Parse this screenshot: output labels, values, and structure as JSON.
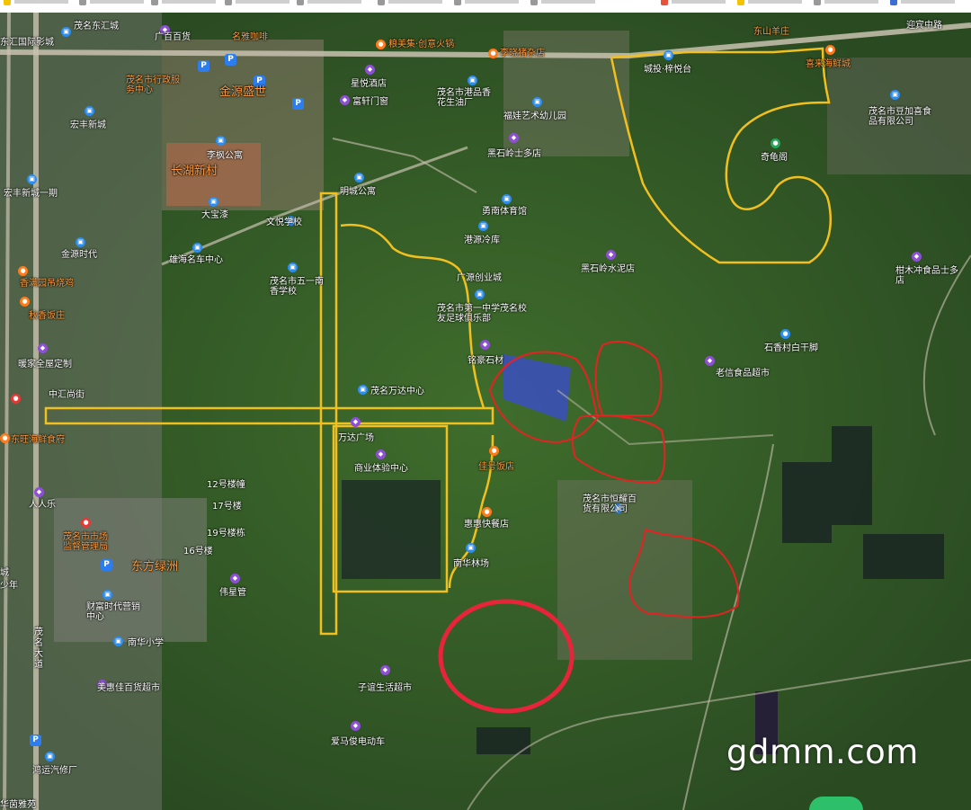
{
  "watermark": "gdmm.com",
  "colors": {
    "yellow_outline": "#f2c01e",
    "red_outline": "#e52222",
    "red_circle": "#e8243a",
    "road": "#c9c2b0"
  },
  "labels": {
    "mz_donghui": "茂名东汇城",
    "guangbai": "广百百货",
    "mingya": "名雅咖啡",
    "dongshan": "东山羊庄",
    "dongjiang": "东汇国际影城",
    "genmeiji": "粮美集·创意火锅",
    "lixiao": "李晓猪杂店",
    "chengtou": "城投·梓悦台",
    "xilai": "喜来海鲜城",
    "admin_center": "茂名市行政服务中心",
    "jinyuan": "金源盛世",
    "xingyue": "星悦酒店",
    "hongfeng": "宏丰新城",
    "fuxuan": "富轩门窗",
    "gangpin": "茂名市港品香花生油厂",
    "fuxin_art": "福娃艺术幼儿园",
    "douliaxi": "茂名市豆加喜食品有限公司",
    "liyu": "李枫公寓",
    "changhu": "长湖新村",
    "heishiling_dorm": "黑石岭士多店",
    "guimian": "奇龟阁",
    "hongfeng_1": "宏丰新城一期",
    "mingcheng": "明城公寓",
    "yongnan": "勇南体育馆",
    "dadao": "大宝漆",
    "wenyue": "文悦学校",
    "jinyuan_time": "金源时代",
    "haihai_car": "雄海名车中心",
    "gangyuan": "港源冷库",
    "heishiling_cement": "黑石岭水泥店",
    "ganmu": "柑木冲食品士多店",
    "xiangman": "香满园吊烧鸡",
    "fifth_school": "茂名市五一南香学校",
    "guangyuan": "广源创业城",
    "qiuyi": "秋香饭庄",
    "first_school": "茂名市第一中学茂名校友足球俱乐部",
    "shixiang": "石香村白干脚",
    "nuanjia": "暖家全屋定制",
    "lingshang": "铭豪石材",
    "laoxin": "老信食品超市",
    "zhonghui": "中汇尚街",
    "wanda_center": "茂名万达中心",
    "dongwang": "东旺海鲜食府",
    "wanda_plaza": "万达广场",
    "biz_center": "商业体验中心",
    "jiahao": "佳号饭店",
    "b12": "12号楼幢",
    "b17": "17号楼",
    "hengzhan": "茂名市恒耀百货有限公司",
    "renrenle": "人人乐",
    "market_admin": "茂名市市场监督管理局",
    "b19": "19号楼栋",
    "b16": "16号楼",
    "huihui": "惠惠快餐店",
    "dongfang": "东方绿洲",
    "nanhua_forest": "南华林场",
    "city_lbl": "城",
    "shaoxian": "少年",
    "caifu": "财富时代营销中心",
    "weixing": "伟星管",
    "nanhua_school": "南华小学",
    "maoming_ave": "茂名大道",
    "meihui": "美惠佳百货超市",
    "ziyi": "子谊生活超市",
    "aima": "爱马俊电动车",
    "hongyun": "鸿运汽修厂",
    "huahua": "华茵雅苑",
    "road_north": "迎宾中路"
  }
}
